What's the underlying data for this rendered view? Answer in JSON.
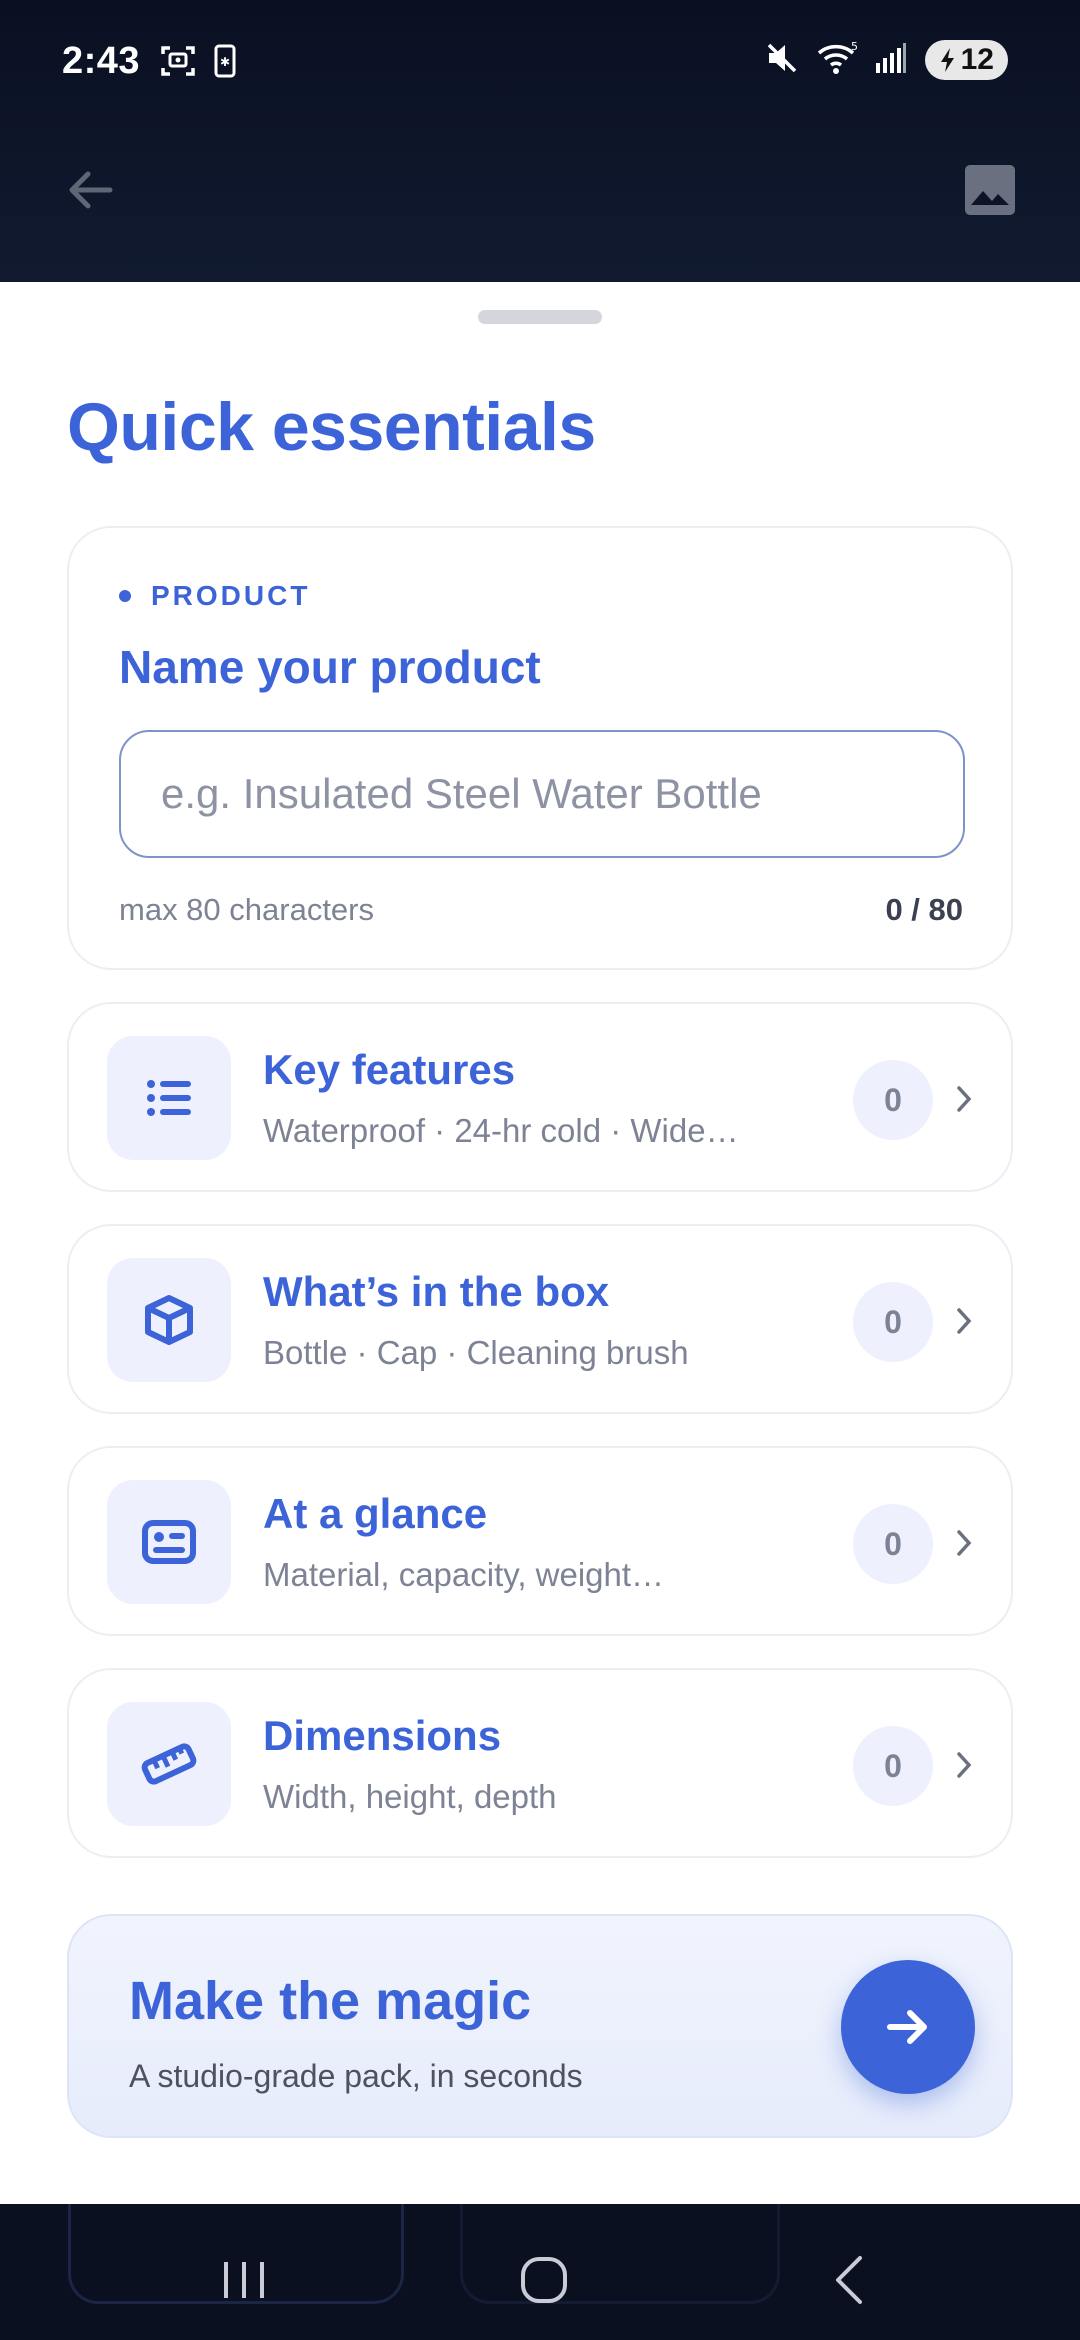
{
  "status_bar": {
    "time": "2:43",
    "battery_level": "12",
    "icons": [
      "screenshot-icon",
      "sim-icon",
      "mute-icon",
      "wifi-icon",
      "signal-icon",
      "battery-icon"
    ]
  },
  "app_bar": {
    "back_icon": "arrow-left-icon",
    "image_icon": "image-icon"
  },
  "sheet": {
    "title": "Quick essentials",
    "product": {
      "eyebrow": "PRODUCT",
      "heading": "Name your product",
      "input_value": "",
      "input_placeholder": "e.g. Insulated Steel Water Bottle",
      "helper": "max 80 characters",
      "count": "0 / 80"
    },
    "items": [
      {
        "icon": "list-icon",
        "title": "Key features",
        "subtitle": "Waterproof · 24-hr cold · Wide…",
        "count": "0"
      },
      {
        "icon": "box-icon",
        "title": "What’s in the box",
        "subtitle": "Bottle · Cap · Cleaning brush",
        "count": "0"
      },
      {
        "icon": "id-card-icon",
        "title": "At a glance",
        "subtitle": "Material, capacity, weight…",
        "count": "0"
      },
      {
        "icon": "ruler-icon",
        "title": "Dimensions",
        "subtitle": "Width, height, depth",
        "count": "0"
      }
    ],
    "cta": {
      "title": "Make the magic",
      "subtitle": "A studio-grade pack, in seconds",
      "button_icon": "arrow-right-icon"
    }
  },
  "nav_bar": {
    "buttons": [
      "recents-icon",
      "home-icon",
      "back-icon"
    ]
  },
  "colors": {
    "accent": "#3c64d8",
    "accent_tint": "#eef1fd",
    "header_bg": "#0a1022",
    "muted_text": "#7d8394"
  }
}
